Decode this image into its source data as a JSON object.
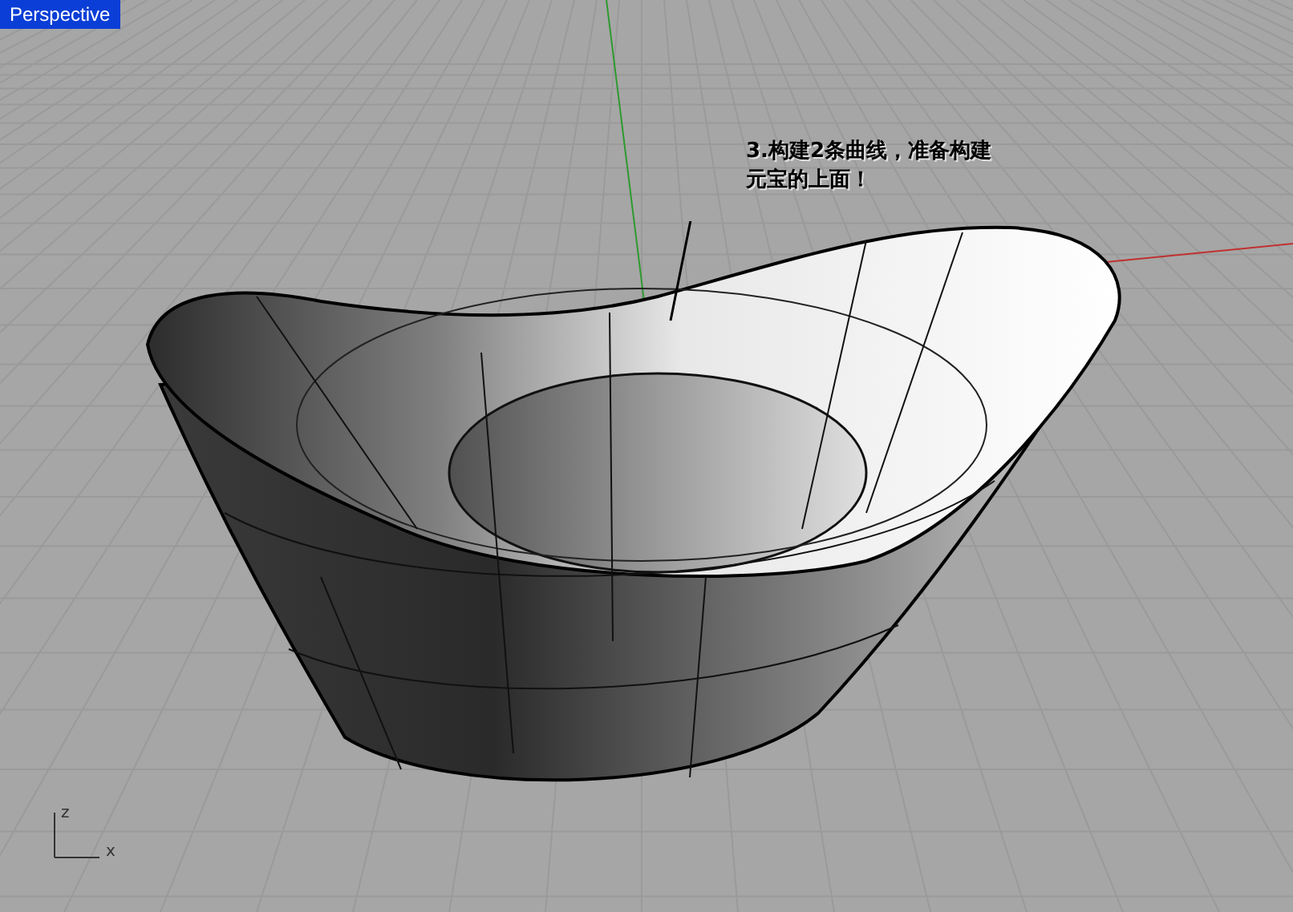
{
  "viewport": {
    "title": "Perspective",
    "selected": true
  },
  "annotation": {
    "lines": [
      "3.构建2条曲线，准备构建",
      "元宝的上面！"
    ]
  },
  "axis_labels": [
    "z",
    "x"
  ]
}
